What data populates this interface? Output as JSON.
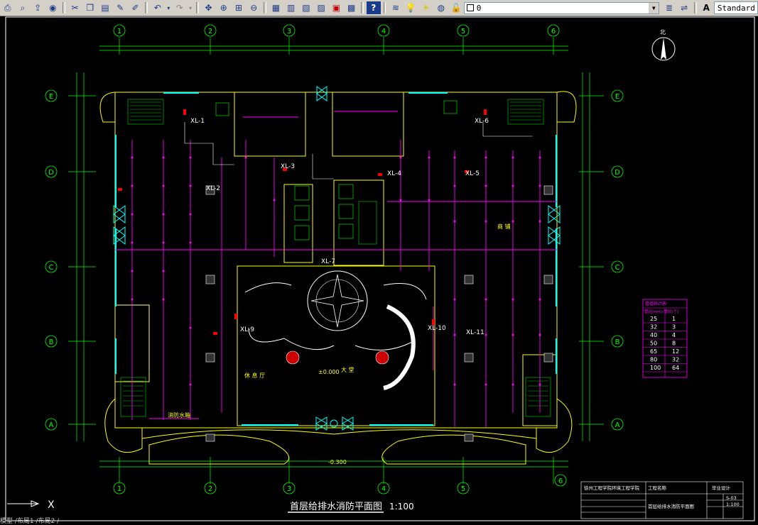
{
  "toolbar": {
    "layer_value": "0",
    "style_value": "Standard"
  },
  "drawing": {
    "title": "首层给排水消防平面图",
    "scale": "1:100",
    "grid_numbers": [
      "①",
      "②",
      "③",
      "④",
      "⑤",
      "⑥"
    ],
    "grid_letters": [
      "Ⓔ",
      "Ⓓ",
      "Ⓒ",
      "Ⓑ",
      "Ⓐ"
    ],
    "pipe_labels": {
      "xl1": "XL-1",
      "xl2": "XL-2",
      "xl3": "XL-3",
      "xl4": "XL-4",
      "xl5": "XL-5",
      "xl6": "XL-6",
      "xl7": "XL-7",
      "xl9": "XL-9",
      "xl10": "XL-10",
      "xl11": "XL-11"
    },
    "room_labels": {
      "hall": "大 堂",
      "level": "±0.000",
      "outdoor_level": "-0.300",
      "shop": "商 铺",
      "water_tank": "消防水箱",
      "dining": "休 息 厅"
    },
    "north_label": "北"
  },
  "pipe_table": {
    "header": "管径(mm) 管长(个)",
    "rows": [
      [
        "25",
        "1"
      ],
      [
        "32",
        "3"
      ],
      [
        "40",
        "4"
      ],
      [
        "50",
        "8"
      ],
      [
        "65",
        "12"
      ],
      [
        "80",
        "32"
      ],
      [
        "100",
        "64"
      ]
    ]
  },
  "title_block": {
    "school": "徐州工程学院环境工程学院",
    "project": "工程名称",
    "drawing_name": "首层给排水消防平面图",
    "grad": "毕业设计",
    "sheet_no": "S-03",
    "scale": "1:100"
  },
  "ucs": {
    "x_label": "X"
  },
  "command_line": "模型 /布局1 /布局2 /"
}
